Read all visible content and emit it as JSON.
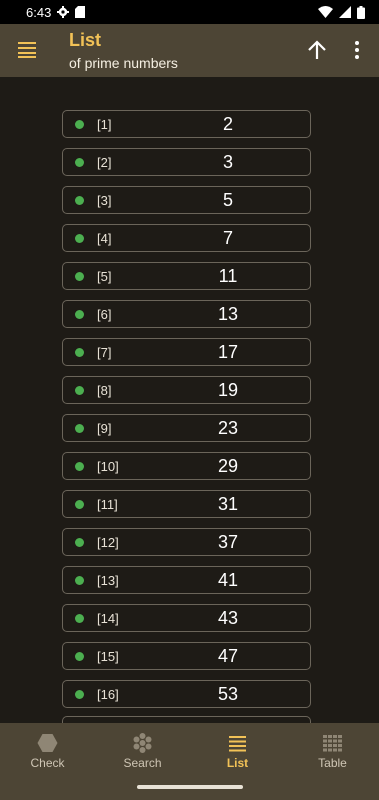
{
  "status_bar": {
    "time": "6:43"
  },
  "app_bar": {
    "title": "List",
    "subtitle": "of prime numbers"
  },
  "primes": [
    {
      "index": "[1]",
      "value": "2"
    },
    {
      "index": "[2]",
      "value": "3"
    },
    {
      "index": "[3]",
      "value": "5"
    },
    {
      "index": "[4]",
      "value": "7"
    },
    {
      "index": "[5]",
      "value": "11"
    },
    {
      "index": "[6]",
      "value": "13"
    },
    {
      "index": "[7]",
      "value": "17"
    },
    {
      "index": "[8]",
      "value": "19"
    },
    {
      "index": "[9]",
      "value": "23"
    },
    {
      "index": "[10]",
      "value": "29"
    },
    {
      "index": "[11]",
      "value": "31"
    },
    {
      "index": "[12]",
      "value": "37"
    },
    {
      "index": "[13]",
      "value": "41"
    },
    {
      "index": "[14]",
      "value": "43"
    },
    {
      "index": "[15]",
      "value": "47"
    },
    {
      "index": "[16]",
      "value": "53"
    }
  ],
  "bottom_nav": {
    "items": [
      {
        "label": "Check",
        "icon": "hexagon-icon"
      },
      {
        "label": "Search",
        "icon": "flower-icon"
      },
      {
        "label": "List",
        "icon": "list-icon"
      },
      {
        "label": "Table",
        "icon": "grid-icon"
      }
    ],
    "active": "List"
  },
  "colors": {
    "accent": "#f2c257",
    "app_bar": "#4d4535",
    "background": "#1e1b16",
    "dot": "#4caf50"
  }
}
